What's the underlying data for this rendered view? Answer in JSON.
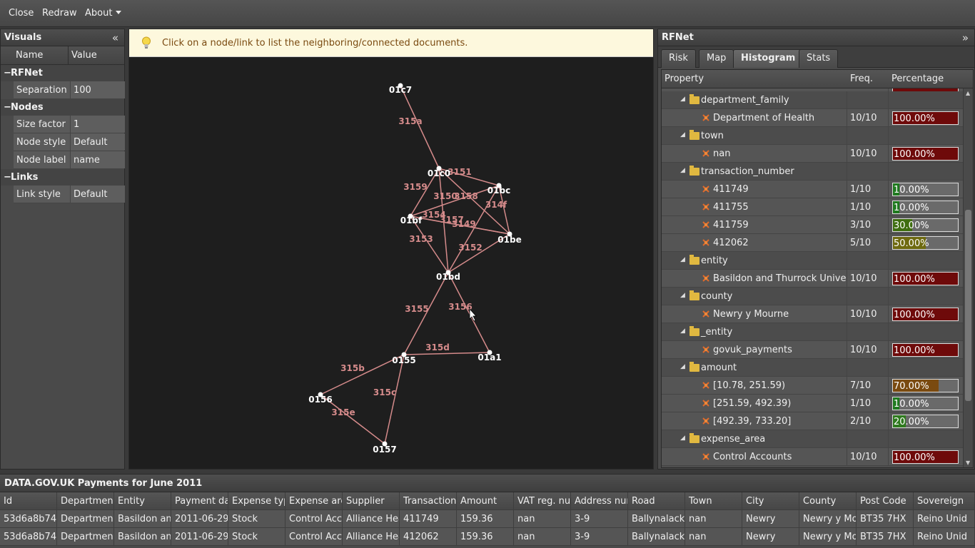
{
  "menubar": {
    "close": "Close",
    "redraw": "Redraw",
    "about": "About"
  },
  "visuals": {
    "title": "Visuals",
    "collapse": "«",
    "col_name": "Name",
    "col_value": "Value",
    "categories": [
      {
        "label": "RFNet",
        "rows": [
          {
            "name": "Separation",
            "value": "100"
          }
        ]
      },
      {
        "label": "Nodes",
        "rows": [
          {
            "name": "Size factor",
            "value": "1"
          },
          {
            "name": "Node style",
            "value": "Default"
          },
          {
            "name": "Node label",
            "value": "name"
          }
        ]
      },
      {
        "label": "Links",
        "rows": [
          {
            "name": "Link style",
            "value": "Default"
          }
        ]
      }
    ]
  },
  "hint": {
    "message": "Click on a node/link to list the neighboring/connected documents."
  },
  "graph": {
    "link_color": "#d58b8b",
    "nodes": [
      "01c7",
      "01c0",
      "01bc",
      "01bf",
      "01be",
      "01bd",
      "0155",
      "01a1",
      "0156",
      "0157"
    ],
    "links": [
      {
        "label": "315a",
        "from": "01c7",
        "to": "01c0"
      },
      {
        "label": "3151",
        "from": "01c0",
        "to": "01bc"
      },
      {
        "label": "3159",
        "from": "01c0",
        "to": "01bf"
      },
      {
        "label": "3150",
        "from": "01c0",
        "to": "01bd"
      },
      {
        "label": "3158",
        "from": "01c0",
        "to": "01be"
      },
      {
        "label": "314f",
        "from": "01bc",
        "to": "01be"
      },
      {
        "label": "3154",
        "from": "01bf",
        "to": "01bc"
      },
      {
        "label": "3157",
        "from": "01bf",
        "to": "01be"
      },
      {
        "label": "3149",
        "from": "01bf",
        "to": "01be"
      },
      {
        "label": "3153",
        "from": "01bf",
        "to": "01bd"
      },
      {
        "label": "3152",
        "from": "01bd",
        "to": "01be"
      },
      {
        "label": "",
        "from": "01bd",
        "to": "01bc"
      },
      {
        "label": "3155",
        "from": "01bd",
        "to": "0155"
      },
      {
        "label": "3156",
        "from": "01bd",
        "to": "01a1"
      },
      {
        "label": "315d",
        "from": "0155",
        "to": "01a1"
      },
      {
        "label": "315b",
        "from": "0155",
        "to": "0156"
      },
      {
        "label": "315c",
        "from": "0155",
        "to": "0157"
      },
      {
        "label": "315e",
        "from": "0156",
        "to": "0157"
      }
    ]
  },
  "rfnet": {
    "title": "RFNet",
    "expand": "»",
    "tabs": [
      "Risk",
      "Map",
      "Histogram",
      "Stats"
    ],
    "active_tab": "Histogram",
    "columns": {
      "property": "Property",
      "freq": "Freq.",
      "percentage": "Percentage"
    },
    "rows": [
      {
        "type": "group",
        "label": "department_family"
      },
      {
        "type": "leaf",
        "label": "Department of Health",
        "freq": "10/10",
        "pct": "100.00%",
        "value": 1.0,
        "color": "#6e0a0a"
      },
      {
        "type": "group",
        "label": "town"
      },
      {
        "type": "leaf",
        "label": "nan",
        "freq": "10/10",
        "pct": "100.00%",
        "value": 1.0,
        "color": "#6e0a0a"
      },
      {
        "type": "group",
        "label": "transaction_number"
      },
      {
        "type": "leaf",
        "label": "411749",
        "freq": "1/10",
        "pct": "10.00%",
        "value": 0.1,
        "color": "#1f7a1f"
      },
      {
        "type": "leaf",
        "label": "411755",
        "freq": "1/10",
        "pct": "10.00%",
        "value": 0.1,
        "color": "#1f7a1f"
      },
      {
        "type": "leaf",
        "label": "411759",
        "freq": "3/10",
        "pct": "30.00%",
        "value": 0.3,
        "color": "#3f6e10"
      },
      {
        "type": "leaf",
        "label": "412062",
        "freq": "5/10",
        "pct": "50.00%",
        "value": 0.5,
        "color": "#6e6a10"
      },
      {
        "type": "group",
        "label": "entity"
      },
      {
        "type": "leaf",
        "label": "Basildon and Thurrock University",
        "freq": "10/10",
        "pct": "100.00%",
        "value": 1.0,
        "color": "#6e0a0a"
      },
      {
        "type": "group",
        "label": "county"
      },
      {
        "type": "leaf",
        "label": "Newry y Mourne",
        "freq": "10/10",
        "pct": "100.00%",
        "value": 1.0,
        "color": "#6e0a0a"
      },
      {
        "type": "group",
        "label": "_entity"
      },
      {
        "type": "leaf",
        "label": "govuk_payments",
        "freq": "10/10",
        "pct": "100.00%",
        "value": 1.0,
        "color": "#6e0a0a"
      },
      {
        "type": "group",
        "label": "amount"
      },
      {
        "type": "leaf",
        "label": "[10.78, 251.59)",
        "freq": "7/10",
        "pct": "70.00%",
        "value": 0.7,
        "color": "#7a4a10"
      },
      {
        "type": "leaf",
        "label": "[251.59, 492.39)",
        "freq": "1/10",
        "pct": "10.00%",
        "value": 0.1,
        "color": "#1f7a1f"
      },
      {
        "type": "leaf",
        "label": "[492.39, 733.20]",
        "freq": "2/10",
        "pct": "20.00%",
        "value": 0.2,
        "color": "#2f7a1f"
      },
      {
        "type": "group",
        "label": "expense_area"
      },
      {
        "type": "leaf",
        "label": "Control Accounts",
        "freq": "10/10",
        "pct": "100.00%",
        "value": 1.0,
        "color": "#6e0a0a"
      }
    ]
  },
  "table": {
    "title": "DATA.GOV.UK Payments for June 2011",
    "headers": [
      "Id",
      "Department",
      "Entity",
      "Payment dat",
      "Expense typ",
      "Expense are",
      "Supplier",
      "Transaction n",
      "Amount",
      "VAT reg. nur",
      "Address num",
      "Road",
      "Town",
      "City",
      "County",
      "Post Code",
      "Sovereign"
    ],
    "rows": [
      [
        "53d6a8b74c",
        "Department",
        "Basildon and",
        "2011-06-29",
        "Stock",
        "Control Acco",
        "Alliance Heal",
        "411749",
        "159.36",
        "nan",
        "3-9",
        "Ballynalack L",
        "nan",
        "Newry",
        "Newry y Mou",
        "BT35 7HX",
        "Reino Unid"
      ],
      [
        "53d6a8b74c",
        "Department",
        "Basildon and",
        "2011-06-29",
        "Stock",
        "Control Acco",
        "Alliance Heal",
        "412062",
        "159.36",
        "nan",
        "3-9",
        "Ballynalack L",
        "nan",
        "Newry",
        "Newry y Mou",
        "BT35 7HX",
        "Reino Unid"
      ]
    ]
  }
}
